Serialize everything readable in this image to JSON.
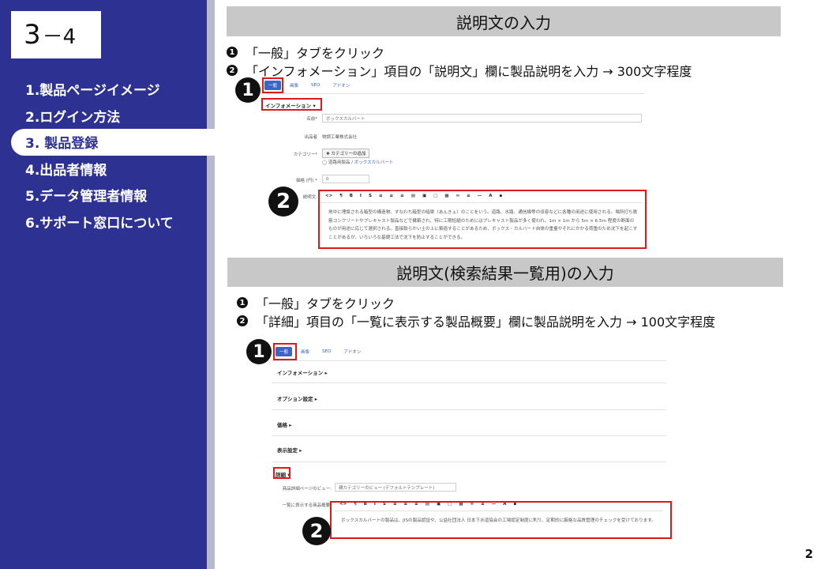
{
  "slide_number": {
    "big": "3",
    "small": "－4"
  },
  "menu": [
    {
      "label": "1.製品ページイメージ"
    },
    {
      "label": "2.ログイン方法"
    },
    {
      "label": "3. 製品登録"
    },
    {
      "label": "4.出品者情報"
    },
    {
      "label": "5.データ管理者情報"
    },
    {
      "label": "6.サポート窓口について"
    }
  ],
  "section1": {
    "title": "説明文の入力",
    "step1_num": "1",
    "step1": "「一般」タブをクリック",
    "step2_num": "2",
    "step2": "「インフォメーション」項目の「説明文」欄に製品説明を入力 → 300文字程度",
    "tabs": [
      "一般",
      "画像",
      "SEO",
      "アドオン"
    ],
    "info_header": "インフォメーション ▾",
    "name_label": "名前*",
    "name_value": "ボックスカルバート",
    "maker_label": "出品者",
    "maker_value": "物調工業株式会社",
    "category_label": "カテゴリー*",
    "category_button": "✚ カテゴリーの追加",
    "category_path_prefix": "◯ 道路用製品 / ",
    "category_path_link": "ボックスカルバート",
    "price_label": "価格 (円) *",
    "price_value": "0",
    "desc_label": "説明文:",
    "toolbar": [
      "<>",
      "¶",
      "B",
      "I",
      "S",
      "≡",
      "≡",
      "≡",
      "▤",
      "▣",
      "▢",
      "▦",
      "∞",
      "≡",
      "—",
      "A",
      "▪"
    ],
    "desc_text": "地中に埋設される箱型の構造物、すなわち箱型の暗渠（あんきょ）のことをいう。道路、水路、通信線等の収容などに各種の用途に使用される。場所打ち鉄筋コンクリートやプレキャスト製品などで構築され、特に工期短縮のためにはプレキャスト製品が多く使われ、1m × 1m から 5m × 6.5m 程度の断面のものが用途に応じて選択される。直接軟らかい土の上に築造することがあるため、ボックス・カルバート自体の重量やそれにかかる荷重のため沈下を起こすことがあるが、いろいろな基礎工法で沈下を防止することができる。",
    "badge1": "1",
    "badge2": "2"
  },
  "section2": {
    "title": "説明文(検索結果一覧用)の入力",
    "step1_num": "1",
    "step1": "「一般」タブをクリック",
    "step2_num": "2",
    "step2": "「詳細」項目の「一覧に表示する製品概要」欄に製品説明を入力 → 100文字程度",
    "tabs": [
      "一般",
      "画像",
      "SEO",
      "アドオン"
    ],
    "collapsibles": [
      "インフォメーション ▸",
      "オプション設定 ▸",
      "価格 ▸",
      "表示設定 ▸"
    ],
    "detail_header": "詳細 ▾",
    "view_label": "商品詳細ページのビュー:",
    "view_value": "親カテゴリーのビュー (デフォルトテンプレート)",
    "summary_label": "一覧に表示する商品概要:",
    "toolbar": [
      "<>",
      "¶",
      "B",
      "I",
      "S",
      "≡",
      "≡",
      "≡",
      "▤",
      "▣",
      "▢",
      "▦",
      "∞",
      "≡",
      "—",
      "A",
      "▪"
    ],
    "summary_text": "ボックスカルバートの製品は、JISの製品認証や、公益社団法人 日本下水道協会の工場認定制度に則り、定期的に厳格な品質管理のチェックを受けております。",
    "badge1": "1",
    "badge2": "2"
  },
  "page_number": "2",
  "colors": {
    "sidebar": "#2d3192",
    "highlight": "#e01818",
    "tab_blue": "#3a66c8",
    "header_gray": "#c8c8c8"
  }
}
